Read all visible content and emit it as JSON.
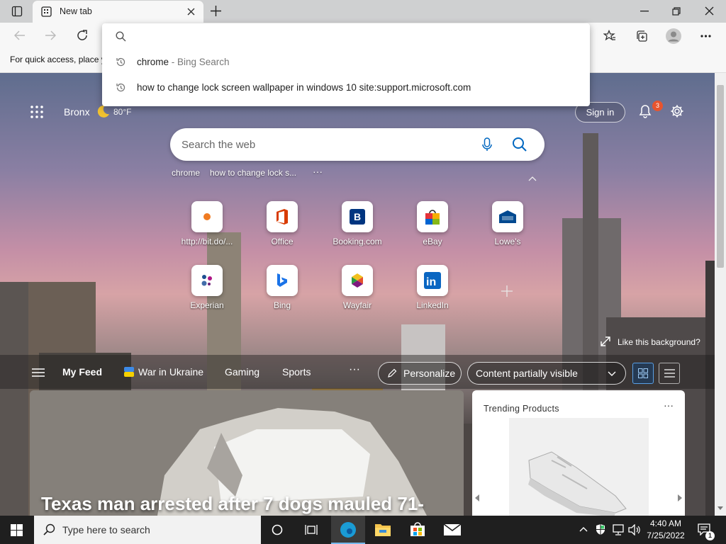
{
  "tab": {
    "title": "New tab"
  },
  "favorites_bar": {
    "text": "For quick access, place y"
  },
  "omnibox": {
    "suggestions": [
      {
        "term": "chrome",
        "source": " - Bing Search"
      },
      {
        "term": "how to change lock screen wallpaper in windows 10 site:support.microsoft.com",
        "source": ""
      }
    ]
  },
  "header": {
    "location": "Bronx",
    "temperature": "80",
    "unit": "°F",
    "sign_in": "Sign in",
    "notification_count": "3"
  },
  "search": {
    "placeholder": "Search the web",
    "recent": [
      "chrome",
      "how to change lock s...",
      "···"
    ]
  },
  "top_sites": [
    {
      "label": "http://bit.do/...",
      "icon": "orange-dot-icon"
    },
    {
      "label": "Office",
      "icon": "office-icon"
    },
    {
      "label": "Booking.com",
      "icon": "booking-icon"
    },
    {
      "label": "eBay",
      "icon": "ebay-icon"
    },
    {
      "label": "Lowe's",
      "icon": "lowes-icon"
    },
    {
      "label": "Experian",
      "icon": "experian-icon"
    },
    {
      "label": "Bing",
      "icon": "bing-icon"
    },
    {
      "label": "Wayfair",
      "icon": "wayfair-icon"
    },
    {
      "label": "LinkedIn",
      "icon": "linkedin-icon"
    }
  ],
  "background": {
    "like_text": "Like this background?"
  },
  "feed": {
    "nav": [
      "My Feed",
      "War in Ukraine",
      "Gaming",
      "Sports",
      "···"
    ],
    "personalize": "Personalize",
    "content_visibility": "Content partially visible",
    "headline": "Texas man arrested after 7 dogs mauled 71-",
    "trending_title": "Trending Products",
    "trending_more": "···"
  },
  "taskbar": {
    "search_placeholder": "Type here to search",
    "time": "4:40 AM",
    "date": "7/25/2022",
    "notification_badge": "1"
  },
  "colors": {
    "accent": "#0067c0",
    "notification_badge": "#e8542e",
    "titlebar": "#cfd0d1",
    "toolbar": "#f7f7f7",
    "taskbar": "#1f1f1f"
  }
}
